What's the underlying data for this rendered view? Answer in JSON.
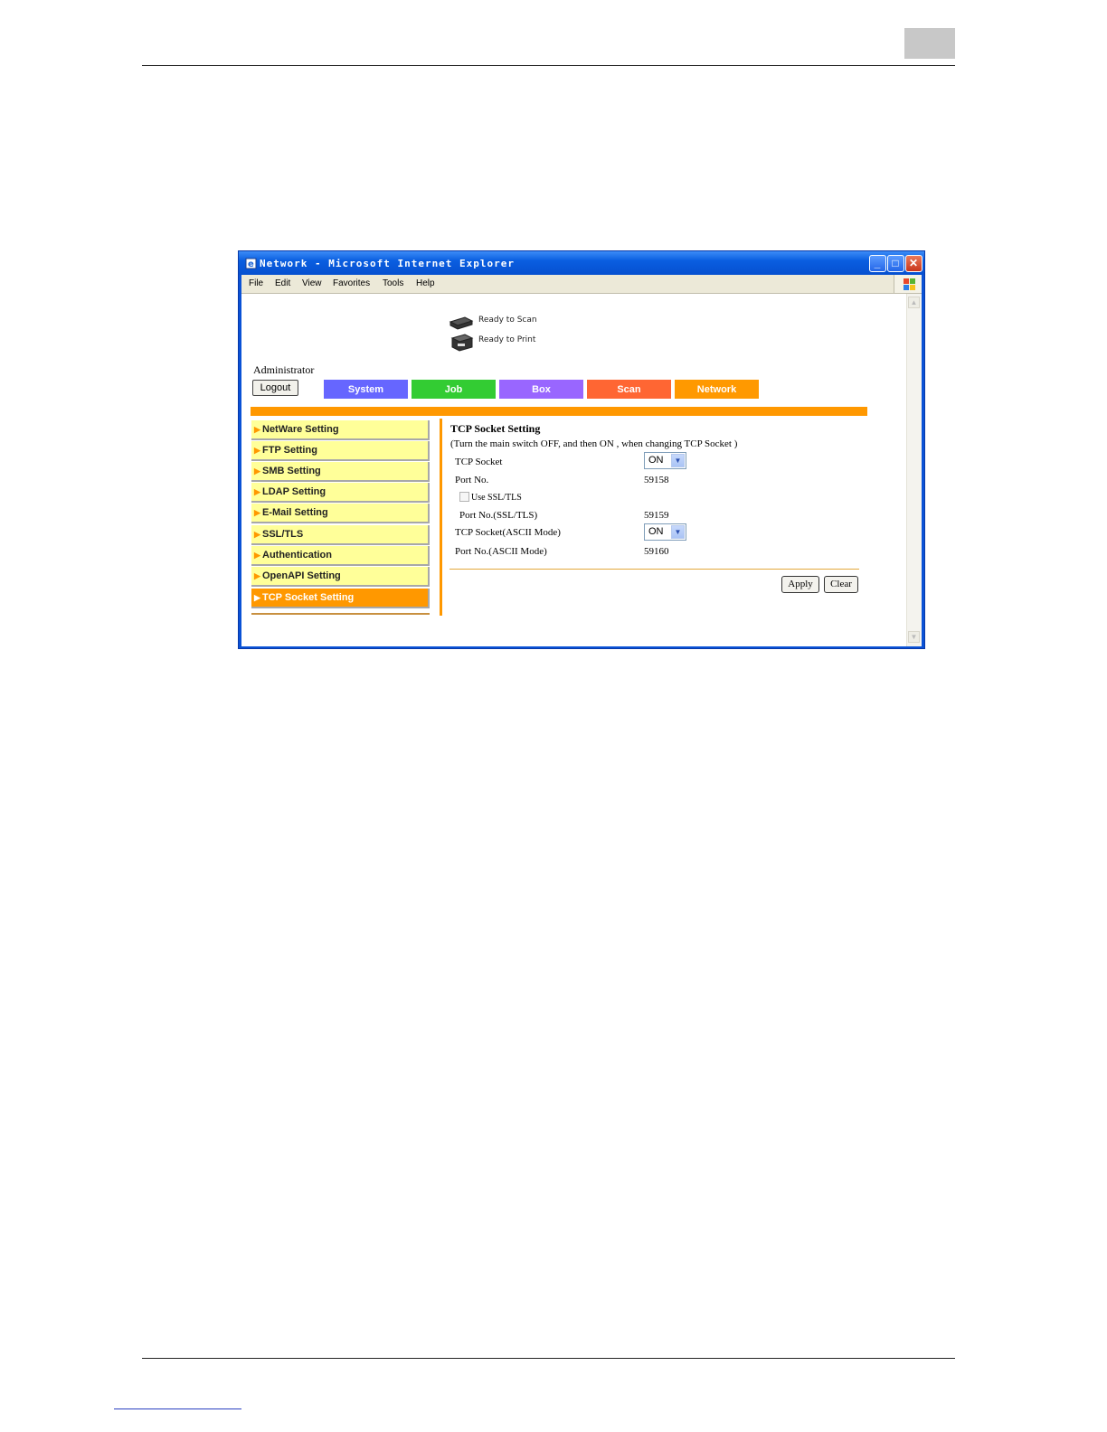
{
  "window": {
    "title": "Network - Microsoft Internet Explorer",
    "controls": {
      "minimize": "_",
      "maximize": "□",
      "close": "✕"
    }
  },
  "menubar": [
    "File",
    "Edit",
    "View",
    "Favorites",
    "Tools",
    "Help"
  ],
  "status": {
    "scan": "Ready to Scan",
    "print": "Ready to Print"
  },
  "user": {
    "label": "Administrator",
    "logout": "Logout"
  },
  "tabs": [
    {
      "label": "System",
      "color": "#6666ff"
    },
    {
      "label": "Job",
      "color": "#33cc33"
    },
    {
      "label": "Box",
      "color": "#9966ff"
    },
    {
      "label": "Scan",
      "color": "#ff6633"
    },
    {
      "label": "Network",
      "color": "#ff9900"
    }
  ],
  "sidebar": {
    "items": [
      {
        "label": "NetWare Setting"
      },
      {
        "label": "FTP Setting"
      },
      {
        "label": "SMB Setting"
      },
      {
        "label": "LDAP Setting"
      },
      {
        "label": "E-Mail Setting"
      },
      {
        "label": "SSL/TLS"
      },
      {
        "label": "Authentication"
      },
      {
        "label": "OpenAPI Setting"
      },
      {
        "label": "TCP Socket Setting",
        "active": true
      }
    ]
  },
  "form": {
    "title": "TCP Socket Setting",
    "note": "(Turn the main switch OFF, and then ON , when changing TCP Socket )",
    "tcp_socket": {
      "label": "TCP Socket",
      "value": "ON"
    },
    "port_no": {
      "label": "Port No.",
      "value": "59158"
    },
    "use_ssl": {
      "label": "Use SSL/TLS",
      "checked": false
    },
    "port_no_ssl": {
      "label": "Port No.(SSL/TLS)",
      "value": "59159"
    },
    "tcp_socket_ascii": {
      "label": "TCP Socket(ASCII Mode)",
      "value": "ON"
    },
    "port_no_ascii": {
      "label": "Port No.(ASCII Mode)",
      "value": "59160"
    },
    "apply": "Apply",
    "clear": "Clear"
  },
  "colors": {
    "accent": "#ff9800",
    "sidebar_bg": "#ffff99",
    "titlebar": "#0a5ee0"
  }
}
